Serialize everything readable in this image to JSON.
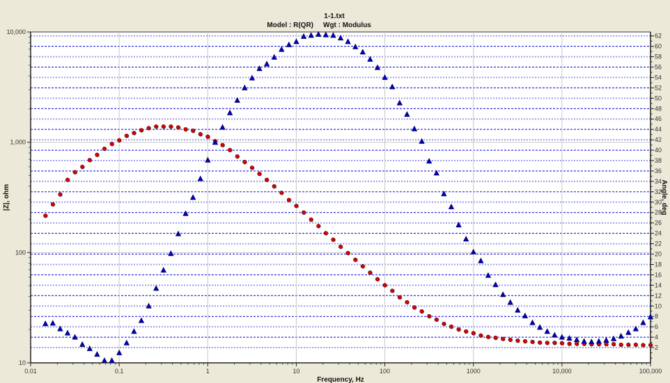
{
  "chart_data": {
    "type": "scatter",
    "title": "1-1.txt",
    "subtitle_model": "Model : R(QR)",
    "subtitle_weight": "Wgt : Modulus",
    "xlabel": "Frequency, Hz",
    "ylabel_left": "|Z|, ohm",
    "ylabel_right": "Angle, deg",
    "xscale": "log",
    "xlim": [
      0.01,
      100000
    ],
    "ylim_left": [
      10,
      10000
    ],
    "ylim_right": [
      -0.94,
      62.76
    ],
    "x_tick_labels": [
      "0.01",
      "0.1",
      "1",
      "10",
      "100",
      "1000",
      "10,000",
      "100,000"
    ],
    "x_tick_values": [
      0.01,
      0.1,
      1,
      10,
      100,
      1000,
      10000,
      100000
    ],
    "y_left_tick_labels": [
      "10",
      "100",
      "1,000",
      "10,000"
    ],
    "y_left_tick_values": [
      10,
      100,
      1000,
      10000
    ],
    "y_right_tick_values": [
      2,
      4,
      6,
      8,
      10,
      12,
      14,
      16,
      18,
      20,
      22,
      24,
      26,
      28,
      30,
      32,
      34,
      36,
      38,
      40,
      42,
      44,
      46,
      48,
      50,
      52,
      54,
      56,
      58,
      60,
      62
    ],
    "y_right_tick_labels": [
      "2",
      "4",
      "6",
      "8",
      "10",
      "12",
      "14",
      "16",
      "18",
      "20",
      "22",
      "24",
      "26",
      "28",
      "30",
      "32",
      "34",
      "36",
      "38",
      "40",
      "42",
      "44",
      "46",
      "48",
      "50",
      "52",
      "54",
      "56",
      "58",
      "60",
      "62"
    ],
    "grid": true,
    "frequency": [
      0.01468,
      0.01778,
      0.02154,
      0.0261,
      0.03162,
      0.03831,
      0.04642,
      0.05623,
      0.06813,
      0.08254,
      0.1,
      0.1212,
      0.1468,
      0.1778,
      0.2154,
      0.261,
      0.3162,
      0.3831,
      0.4642,
      0.5623,
      0.6813,
      0.8254,
      1,
      1.212,
      1.468,
      1.778,
      2.154,
      2.61,
      3.162,
      3.831,
      4.642,
      5.623,
      6.813,
      8.254,
      10,
      12.12,
      14.68,
      17.78,
      21.54,
      26.1,
      31.62,
      38.31,
      46.42,
      56.23,
      68.13,
      82.54,
      100,
      121.2,
      146.8,
      177.8,
      215.4,
      261,
      316.2,
      383.1,
      464.2,
      562.3,
      681.3,
      825.4,
      1000,
      1212,
      1468,
      1778,
      2154,
      2610,
      3162,
      3831,
      4642,
      5623,
      6813,
      8254,
      10000,
      12120,
      14680,
      17780,
      21540,
      26100,
      31620,
      38310,
      46420,
      56230,
      68130,
      82540,
      100000
    ],
    "series": [
      {
        "name": "|Z|",
        "axis": "left",
        "marker": "circle",
        "color": "#E00000",
        "values": [
          216,
          274,
          337,
          457,
          536,
          599,
          690,
          770,
          874,
          967,
          1044,
          1146,
          1214,
          1288,
          1345,
          1390,
          1390,
          1390,
          1364,
          1312,
          1274,
          1185,
          1123,
          1025,
          944,
          852,
          745,
          663,
          588,
          518,
          457,
          399,
          349,
          300,
          265,
          231,
          199,
          174,
          150,
          131,
          113,
          99.1,
          86.1,
          75.2,
          65.8,
          57.4,
          50.6,
          45.1,
          39.3,
          35.5,
          31.8,
          29.3,
          26.5,
          24.7,
          22.6,
          21.3,
          20.1,
          19.3,
          18.6,
          17.7,
          17.2,
          16.9,
          16.5,
          16.2,
          15.9,
          15.7,
          15.5,
          15.3,
          15.2,
          15.2,
          15.1,
          14.9,
          14.9,
          14.9,
          14.8,
          14.8,
          14.8,
          14.8,
          14.6,
          14.6,
          14.6,
          14.5,
          14.5
        ]
      },
      {
        "name": "Angle",
        "axis": "right",
        "marker": "triangle",
        "color": "#0000C8",
        "values": [
          6.6,
          6.7,
          5.6,
          4.8,
          4.0,
          2.6,
          1.8,
          0.7,
          -0.5,
          -0.5,
          1.0,
          2.9,
          5.1,
          7.2,
          10.0,
          13.4,
          16.9,
          20.1,
          23.9,
          27.8,
          30.9,
          34.5,
          38.1,
          41.5,
          44.4,
          47.2,
          49.6,
          52.0,
          53.9,
          55.7,
          56.6,
          57.9,
          59.4,
          60.3,
          60.9,
          61.9,
          62.1,
          62.3,
          62.2,
          62.1,
          61.6,
          60.9,
          59.9,
          58.9,
          57.5,
          55.9,
          54.0,
          52.2,
          49.1,
          46.9,
          44.1,
          41.7,
          37.9,
          35.6,
          31.6,
          29.1,
          25.6,
          22.9,
          20.4,
          18.7,
          15.9,
          14.1,
          12.2,
          10.7,
          9.2,
          8.1,
          6.8,
          5.9,
          5.1,
          4.4,
          4.0,
          3.8,
          3.5,
          3.2,
          3.1,
          3.2,
          3.4,
          3.7,
          4.2,
          4.9,
          5.6,
          6.8,
          7.9
        ]
      }
    ],
    "colors": {
      "background": "#ECE9D8",
      "plot": "#FFFFFF",
      "grid_major": "#C8C8C8",
      "grid_dash_dark": "#0000E0",
      "grid_dash_light": "#9C9CF0"
    }
  }
}
